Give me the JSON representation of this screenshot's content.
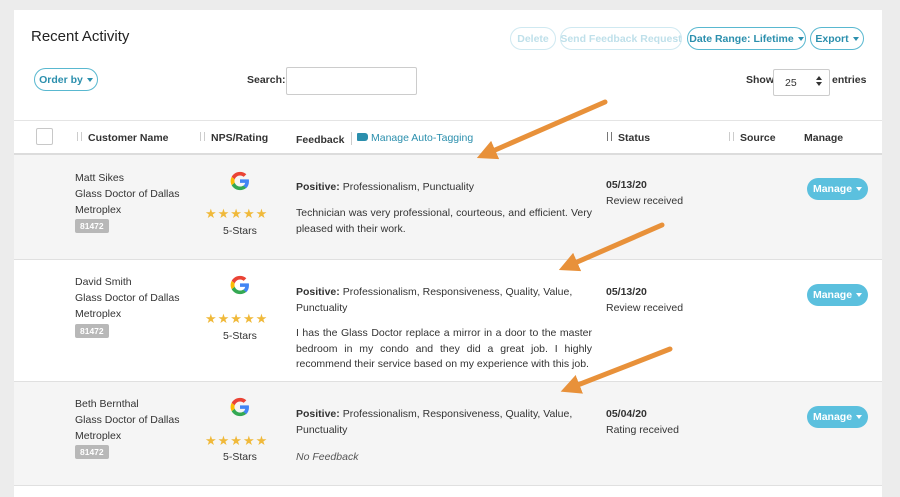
{
  "page": {
    "title": "Recent Activity"
  },
  "toolbar": {
    "delete_label": "Delete",
    "send_feedback_label": "Send Feedback Request",
    "date_range_label": "Date Range: Lifetime",
    "export_label": "Export",
    "order_by_label": "Order by",
    "search_label": "Search:",
    "search_value": "",
    "show_label": "Show",
    "show_value": "25",
    "entries_label": "entries"
  },
  "table": {
    "headers": {
      "customer_name": "Customer Name",
      "nps_rating": "NPS/Rating",
      "feedback": "Feedback",
      "manage_auto_tagging": "Manage Auto-Tagging",
      "status": "Status",
      "source": "Source",
      "manage": "Manage"
    },
    "rows": [
      {
        "name": "Matt Sikes",
        "company_line1": "Glass Doctor of Dallas",
        "company_line2": "Metroplex",
        "badge": "81472",
        "rating_label": "5-Stars",
        "stars": 5,
        "sentiment": "Positive:",
        "tags_line1": "Professionalism, Punctuality",
        "tags_line2": "",
        "feedback": "Technician was very professional, courteous, and efficient. Very pleased with their work.",
        "date": "05/13/20",
        "status": "Review received",
        "manage_label": "Manage"
      },
      {
        "name": "David Smith",
        "company_line1": "Glass Doctor of Dallas",
        "company_line2": "Metroplex",
        "badge": "81472",
        "rating_label": "5-Stars",
        "stars": 5,
        "sentiment": "Positive:",
        "tags_line1": "Professionalism, Responsiveness, Quality, Value,",
        "tags_line2": "Punctuality",
        "feedback": "I has the Glass Doctor replace a mirror in a door to the master bedroom in my condo and they did a great job. I highly recommend their service based on my experience with this job.",
        "date": "05/13/20",
        "status": "Review received",
        "manage_label": "Manage"
      },
      {
        "name": "Beth Bernthal",
        "company_line1": "Glass Doctor of Dallas",
        "company_line2": "Metroplex",
        "badge": "81472",
        "rating_label": "5-Stars",
        "stars": 5,
        "sentiment": "Positive:",
        "tags_line1": "Professionalism, Responsiveness, Quality, Value,",
        "tags_line2": "Punctuality",
        "feedback": "No Feedback",
        "date": "05/04/20",
        "status": "Rating received",
        "manage_label": "Manage"
      }
    ]
  },
  "colors": {
    "accent": "#2b8fad",
    "manage_button": "#5bc0de",
    "star": "#f0b93a",
    "annotation_arrow": "#e8913a"
  },
  "icons": [
    "sort-icon",
    "tag-icon",
    "google-icon",
    "star-icon",
    "caret-down-icon"
  ]
}
